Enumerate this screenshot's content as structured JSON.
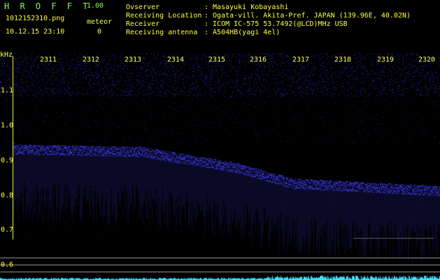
{
  "header": {
    "app_title": "H R O F F T",
    "app_version": "1.00",
    "file_name": "1012152310.png",
    "date_time": "10.12.15 23:10",
    "meteor_label": "meteor",
    "meteor_count": "0"
  },
  "station_info": [
    {
      "key": "Ovserver",
      "value": ": Masayuki Kobayashi"
    },
    {
      "key": "Receiving Location",
      "value": ": Ogata-vill. Akita-Pref. JAPAN (139.96E, 40.02N)"
    },
    {
      "key": "Receiver",
      "value": ": ICOM IC-575 53.7492(@LCD)MHz USB"
    },
    {
      "key": "Receiving antenna",
      "value": ": A504HB(yagi 4el)"
    }
  ],
  "spectrogram": {
    "y_unit": "kHz",
    "x_ticks": [
      "2311",
      "2312",
      "2313",
      "2314",
      "2315",
      "2316",
      "2317",
      "2318",
      "2319",
      "2320"
    ],
    "y_ticks": [
      "1.1",
      "1.0",
      "0.9",
      "0.8",
      "0.7",
      "0.6"
    ],
    "colors": {
      "text": "#ffff40",
      "title": "#7fff55",
      "signal": "#4040ff",
      "noise": "#2a2ad0",
      "baseline": "#40e0ff",
      "axis": "#ffff40"
    }
  }
}
